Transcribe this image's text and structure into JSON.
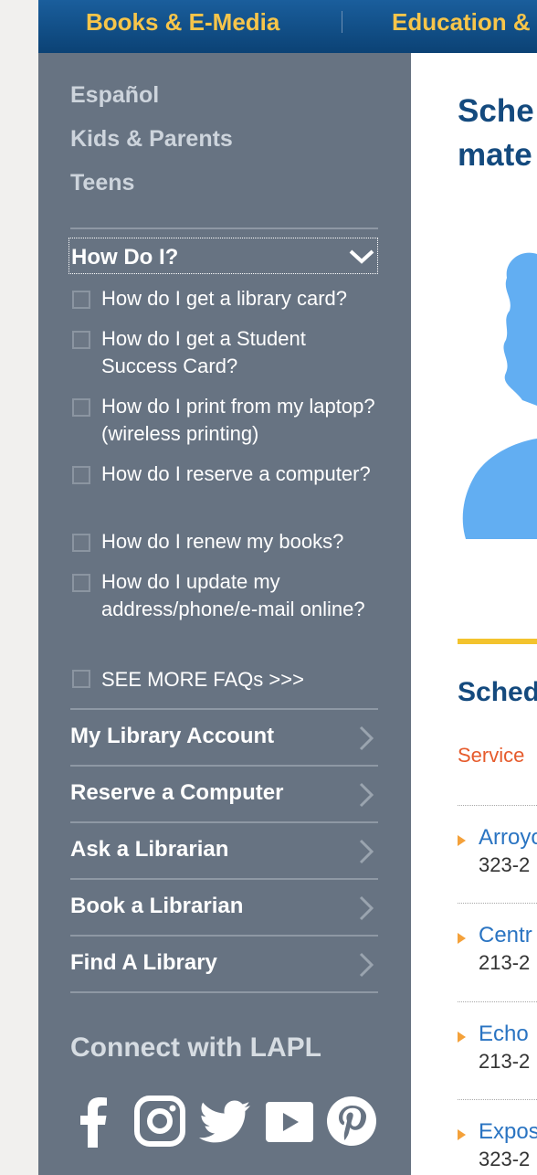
{
  "topnav": {
    "item1": "Books & E-Media",
    "item2": "Education &"
  },
  "sidebar": {
    "languages": [
      "Español",
      "Kids & Parents",
      "Teens"
    ],
    "howdo": {
      "title": "How Do I?",
      "faqs": [
        "How do I get a library card?",
        "How do I get a Student Success Card?",
        "How do I print from my laptop? (wireless printing)",
        "How do I reserve a computer?",
        "How do I renew my books?",
        "How do I update my address/phone/e-mail online?",
        "SEE MORE FAQs >>>"
      ]
    },
    "links": [
      "My Library Account",
      "Reserve a Computer",
      "Ask a Librarian",
      "Book a Librarian",
      "Find A Library"
    ],
    "connect_title": "Connect with LAPL",
    "social_icons": [
      "facebook-icon",
      "instagram-icon",
      "twitter-icon",
      "youtube-icon",
      "pinterest-icon"
    ]
  },
  "main": {
    "heading_line1": "Sche",
    "heading_line2": "mate",
    "subheading": "Sched",
    "service_label": "Service",
    "locations": [
      {
        "name": "Arroyo",
        "phone": "323-2"
      },
      {
        "name": "Centr",
        "phone": "213-2"
      },
      {
        "name": "Echo",
        "phone": "213-2"
      },
      {
        "name": "Expos",
        "phone": "323-2"
      }
    ]
  },
  "colors": {
    "topnav_text": "#f7c54a",
    "sidebar_bg": "#677382",
    "heading": "#144a7e",
    "link": "#2a74c2",
    "service": "#e65b2c",
    "accent_line": "#f3c32d",
    "illustration": "#62aef2"
  }
}
